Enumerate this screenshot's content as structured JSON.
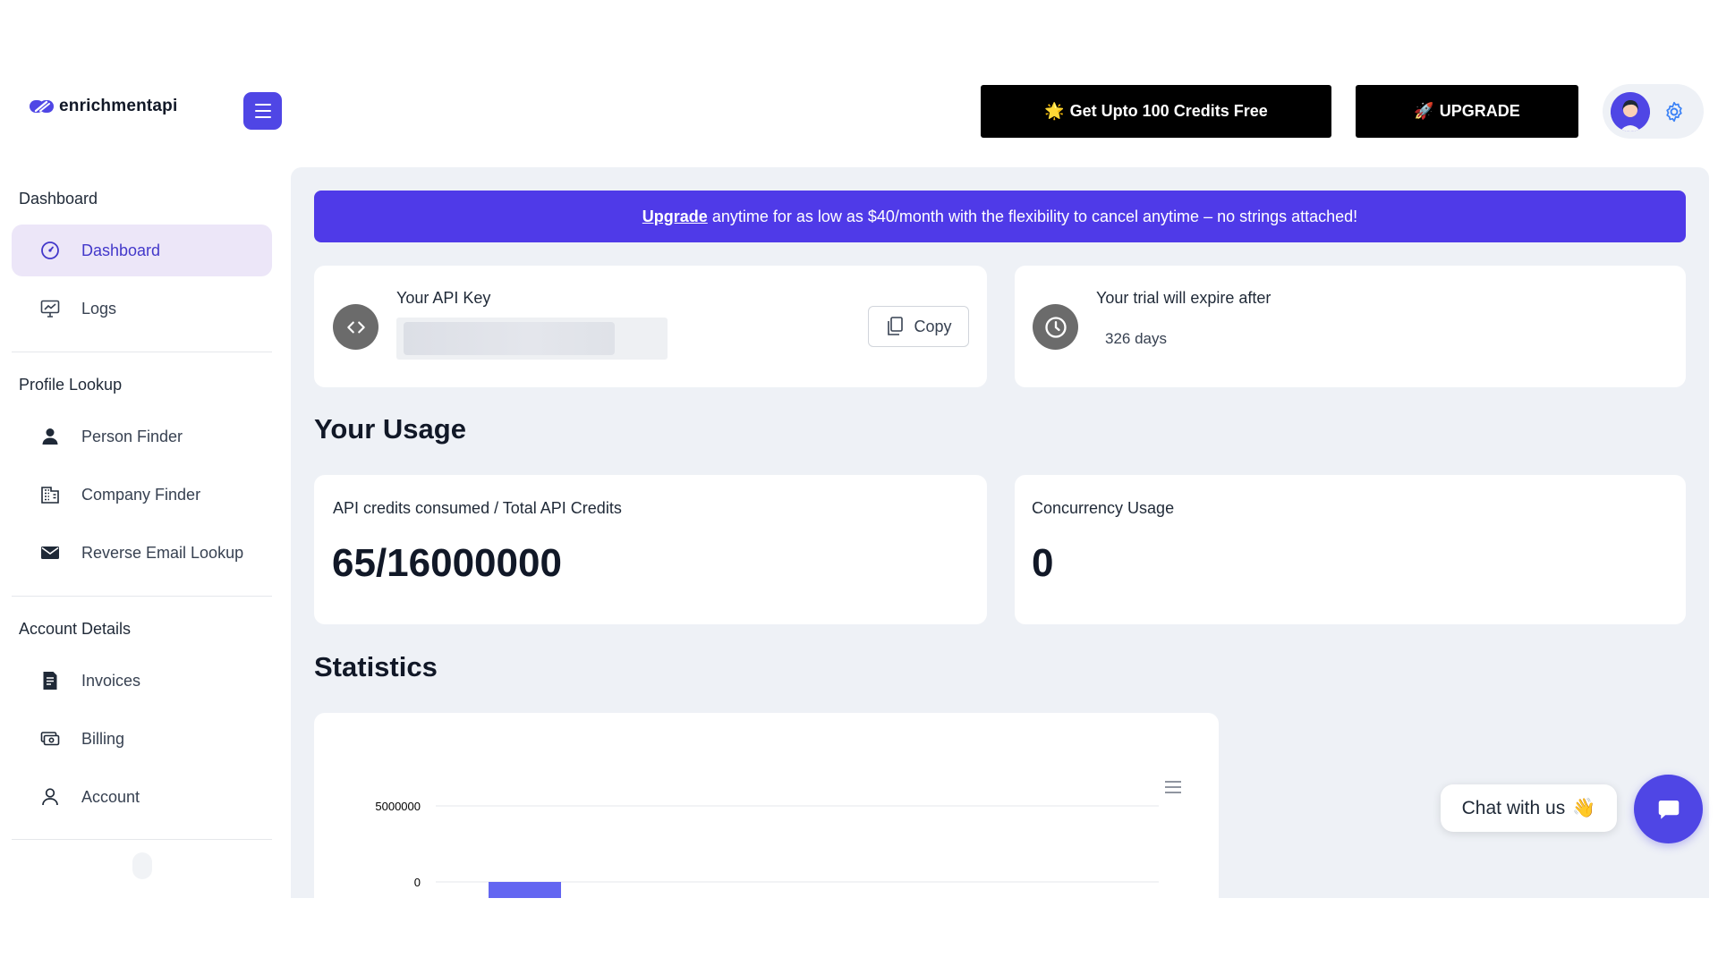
{
  "header": {
    "logo_text": "enrichmentapi",
    "credits_button": {
      "emoji": "🌟",
      "label": "Get Upto 100 Credits Free"
    },
    "upgrade_button": {
      "emoji": "🚀",
      "label": "UPGRADE"
    }
  },
  "sidebar": {
    "sections": [
      {
        "title": "Dashboard"
      },
      {
        "title": "Profile Lookup"
      },
      {
        "title": "Account Details"
      }
    ],
    "items": [
      {
        "label": "Dashboard",
        "icon": "dashboard-gauge-icon",
        "active": true
      },
      {
        "label": "Logs",
        "icon": "monitor-chart-icon"
      },
      {
        "label": "Person Finder",
        "icon": "person-icon"
      },
      {
        "label": "Company Finder",
        "icon": "building-icon"
      },
      {
        "label": "Reverse Email Lookup",
        "icon": "envelope-icon"
      },
      {
        "label": "Invoices",
        "icon": "invoice-document-icon"
      },
      {
        "label": "Billing",
        "icon": "money-icon"
      },
      {
        "label": "Account",
        "icon": "user-outline-icon"
      }
    ]
  },
  "banner": {
    "link_text": "Upgrade",
    "text": "anytime for as low as $40/month with the flexibility to cancel anytime – no strings attached!"
  },
  "api_key": {
    "label": "Your API Key",
    "copy_label": "Copy"
  },
  "trial": {
    "label": "Your trial will expire after",
    "value": "326 days"
  },
  "usage": {
    "title": "Your Usage",
    "credits": {
      "label": "API credits consumed / Total API Credits",
      "value": "65/16000000"
    },
    "concurrency": {
      "label": "Concurrency Usage",
      "value": "0"
    }
  },
  "statistics": {
    "title": "Statistics"
  },
  "chart_data": {
    "type": "bar",
    "y_ticks": [
      "5000000",
      "0"
    ],
    "values": [
      65
    ],
    "ylim": [
      0,
      5000000
    ],
    "bar_color": "#6366f1"
  },
  "chat": {
    "label": "Chat with us",
    "emoji": "👋"
  },
  "colors": {
    "accent": "#4f46e5",
    "banner": "#4f3ae8",
    "main_bg": "#eef1f6",
    "active_item_bg": "#ece6f8"
  }
}
